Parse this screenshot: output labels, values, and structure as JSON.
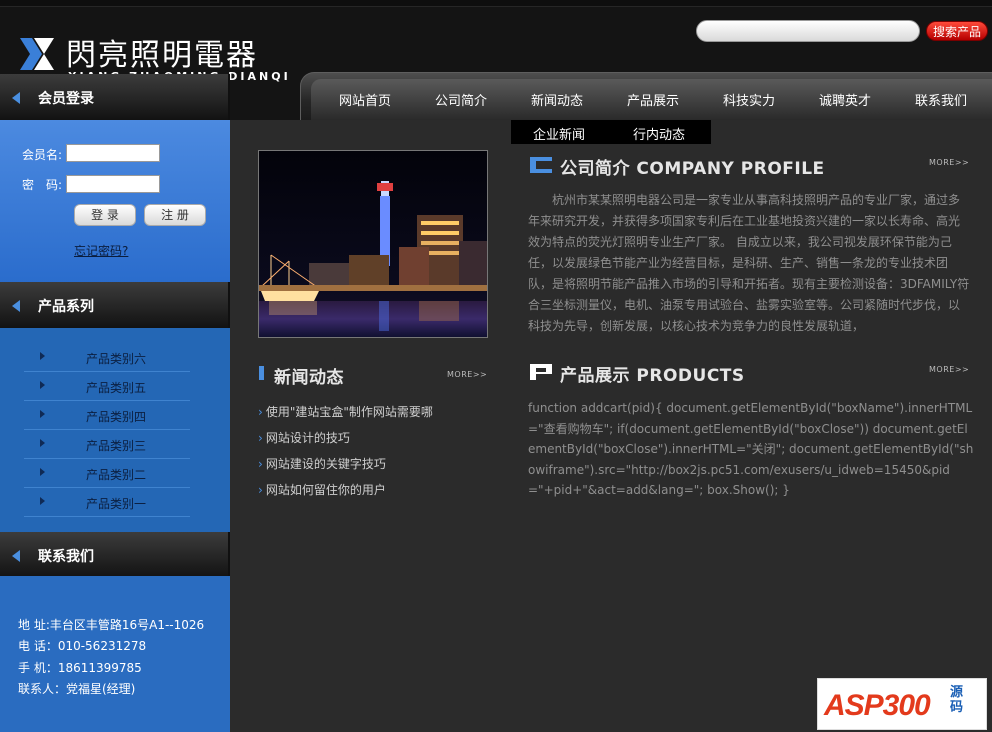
{
  "brand": {
    "name_cn": "閃亮照明電器",
    "name_en": "XIANG ZHAOMING DIANQI"
  },
  "search": {
    "placeholder": "",
    "button_label": "搜索产品"
  },
  "nav": {
    "items": [
      "网站首页",
      "公司简介",
      "新闻动态",
      "产品展示",
      "科技实力",
      "诚聘英才",
      "联系我们"
    ]
  },
  "subnav": {
    "items": [
      "企业新闻",
      "行内动态"
    ]
  },
  "sidebar": {
    "login": {
      "title": "会员登录",
      "username_label": "会员名:",
      "password_label": "密　码:",
      "login_button": "登 录",
      "register_button": "注 册",
      "forgot_link": "忘记密码?"
    },
    "products": {
      "title": "产品系列",
      "items": [
        "产品类别六",
        "产品类别五",
        "产品类别四",
        "产品类别三",
        "产品类别二",
        "产品类别一"
      ]
    },
    "contact": {
      "title": "联系我们",
      "address": "地 址:丰台区丰管路16号A1--1026",
      "phone": "电 话：010-56231278",
      "mobile": "手 机：18611399785",
      "person": "联系人：党福星(经理)"
    }
  },
  "company": {
    "title": "公司简介 COMPANY PROFILE",
    "more": "MORE>>",
    "text": "杭州市某某照明电器公司是一家专业从事高科技照明产品的专业厂家，通过多年来研究开发，并获得多项国家专利后在工业基地投资兴建的一家以长寿命、高光效为特点的荧光灯照明专业生产厂家。 自成立以来，我公司视发展环保节能为己任，以发展绿色节能产业为经营目标，是科研、生产、销售一条龙的专业技术团队，是将照明节能产品推入市场的引导和开拓者。现有主要检测设备：3DFAMILY符合三坐标测量仪，电机、油泵专用试验台、盐雾实验室等。公司紧随时代步伐，以科技为先导，创新发展，以核心技术为竞争力的良性发展轨道，"
  },
  "news": {
    "title": "新闻动态",
    "more": "MORE>>",
    "items": [
      "使用\"建站宝盒\"制作网站需要哪",
      "网站设计的技巧",
      "网站建设的关键字技巧",
      "网站如何留住你的用户"
    ]
  },
  "products_section": {
    "title": "产品展示 PRODUCTS",
    "more": "MORE>>",
    "code": "function addcart(pid){ document.getElementById(\"boxName\").innerHTML=\"查看购物车\"; if(document.getElementById(\"boxClose\")) document.getElementById(\"boxClose\").innerHTML=\"关闭\"; document.getElementById(\"showiframe\").src=\"http://box2js.pc51.com/exusers/u_idweb=15450&pid=\"+pid+\"&act=add&lang=\"; box.Show(); }"
  },
  "watermark": {
    "logo_text": "ASP300",
    "logo_suffix": "源码"
  },
  "colors": {
    "page_bg": "#2b2b2b",
    "sidebar_blue": "#2467b5",
    "accent_blue": "#4a8fe0",
    "search_button_red": "#d01010"
  }
}
